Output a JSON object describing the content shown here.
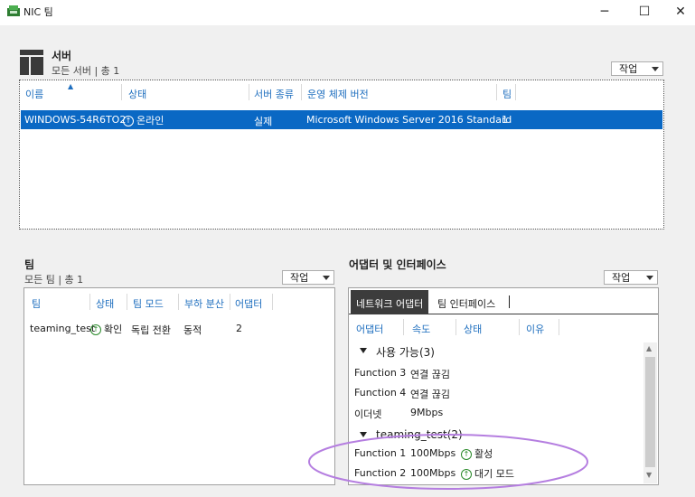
{
  "window": {
    "title": "NIC 팀",
    "minimize": "─",
    "maximize": "☐",
    "close": "✕"
  },
  "servers": {
    "title": "서버",
    "subtitle": "모든 서버 | 총 1",
    "task_label": "작업",
    "columns": [
      "이름",
      "상태",
      "서버 종류",
      "운영 체제 버전",
      "팀"
    ],
    "rows": [
      {
        "name": "WINDOWS-54R6TO2",
        "status": "온라인",
        "type": "실제",
        "os": "Microsoft Windows Server 2016 Standard",
        "team": "1"
      }
    ]
  },
  "teams": {
    "title": "팀",
    "subtitle": "모든 팀 | 총 1",
    "task_label": "작업",
    "columns": [
      "팀",
      "상태",
      "팀 모드",
      "부하 분산",
      "어댑터"
    ],
    "rows": [
      {
        "team": "teaming_test",
        "status": "확인",
        "mode": "독립 전환",
        "lb": "동적",
        "adapters": "2"
      }
    ]
  },
  "adapters": {
    "title": "어댑터 및 인터페이스",
    "task_label": "작업",
    "tabs": [
      "네트워크 어댑터",
      "팀 인터페이스"
    ],
    "columns": [
      "어댑터",
      "속도",
      "상태",
      "이유"
    ],
    "groups": [
      {
        "label": "사용 가능(3)",
        "items": [
          {
            "adapter": "Function 3",
            "speed": "연결 끊김",
            "status": ""
          },
          {
            "adapter": "Function 4",
            "speed": "연결 끊김",
            "status": ""
          },
          {
            "adapter": "이더넷",
            "speed": "9Mbps",
            "status": ""
          }
        ]
      },
      {
        "label": "teaming_test(2)",
        "items": [
          {
            "adapter": "Function 1",
            "speed": "100Mbps",
            "status": "활성"
          },
          {
            "adapter": "Function 2",
            "speed": "100Mbps",
            "status": "대기 모드"
          }
        ]
      }
    ]
  },
  "colors": {
    "selection": "#0a68c4",
    "header_text": "#1f6fbf",
    "status_ok": "#2a8a2a",
    "highlight_ellipse": "#b57ee0"
  }
}
